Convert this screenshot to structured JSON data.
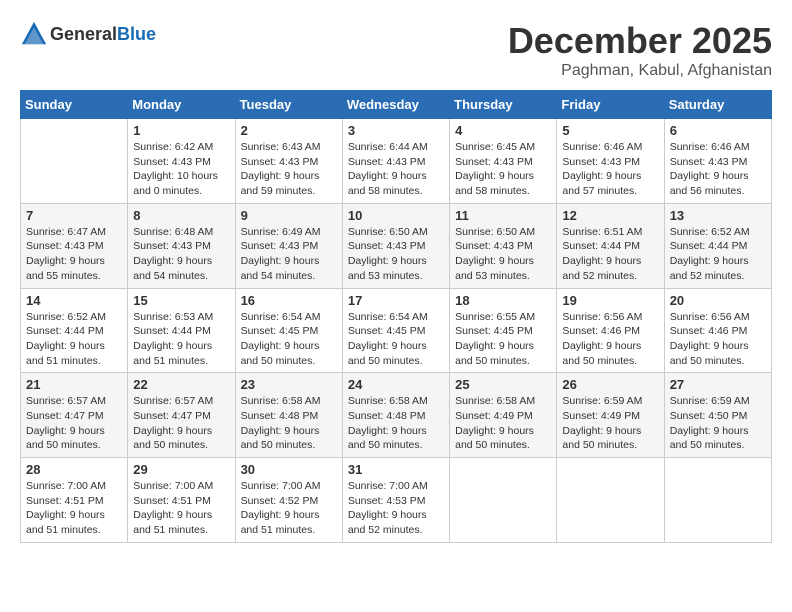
{
  "header": {
    "logo_general": "General",
    "logo_blue": "Blue",
    "month_title": "December 2025",
    "location": "Paghman, Kabul, Afghanistan"
  },
  "weekdays": [
    "Sunday",
    "Monday",
    "Tuesday",
    "Wednesday",
    "Thursday",
    "Friday",
    "Saturday"
  ],
  "weeks": [
    [
      {
        "day": "",
        "sunrise": "",
        "sunset": "",
        "daylight": ""
      },
      {
        "day": "1",
        "sunrise": "Sunrise: 6:42 AM",
        "sunset": "Sunset: 4:43 PM",
        "daylight": "Daylight: 10 hours and 0 minutes."
      },
      {
        "day": "2",
        "sunrise": "Sunrise: 6:43 AM",
        "sunset": "Sunset: 4:43 PM",
        "daylight": "Daylight: 9 hours and 59 minutes."
      },
      {
        "day": "3",
        "sunrise": "Sunrise: 6:44 AM",
        "sunset": "Sunset: 4:43 PM",
        "daylight": "Daylight: 9 hours and 58 minutes."
      },
      {
        "day": "4",
        "sunrise": "Sunrise: 6:45 AM",
        "sunset": "Sunset: 4:43 PM",
        "daylight": "Daylight: 9 hours and 58 minutes."
      },
      {
        "day": "5",
        "sunrise": "Sunrise: 6:46 AM",
        "sunset": "Sunset: 4:43 PM",
        "daylight": "Daylight: 9 hours and 57 minutes."
      },
      {
        "day": "6",
        "sunrise": "Sunrise: 6:46 AM",
        "sunset": "Sunset: 4:43 PM",
        "daylight": "Daylight: 9 hours and 56 minutes."
      }
    ],
    [
      {
        "day": "7",
        "sunrise": "Sunrise: 6:47 AM",
        "sunset": "Sunset: 4:43 PM",
        "daylight": "Daylight: 9 hours and 55 minutes."
      },
      {
        "day": "8",
        "sunrise": "Sunrise: 6:48 AM",
        "sunset": "Sunset: 4:43 PM",
        "daylight": "Daylight: 9 hours and 54 minutes."
      },
      {
        "day": "9",
        "sunrise": "Sunrise: 6:49 AM",
        "sunset": "Sunset: 4:43 PM",
        "daylight": "Daylight: 9 hours and 54 minutes."
      },
      {
        "day": "10",
        "sunrise": "Sunrise: 6:50 AM",
        "sunset": "Sunset: 4:43 PM",
        "daylight": "Daylight: 9 hours and 53 minutes."
      },
      {
        "day": "11",
        "sunrise": "Sunrise: 6:50 AM",
        "sunset": "Sunset: 4:43 PM",
        "daylight": "Daylight: 9 hours and 53 minutes."
      },
      {
        "day": "12",
        "sunrise": "Sunrise: 6:51 AM",
        "sunset": "Sunset: 4:44 PM",
        "daylight": "Daylight: 9 hours and 52 minutes."
      },
      {
        "day": "13",
        "sunrise": "Sunrise: 6:52 AM",
        "sunset": "Sunset: 4:44 PM",
        "daylight": "Daylight: 9 hours and 52 minutes."
      }
    ],
    [
      {
        "day": "14",
        "sunrise": "Sunrise: 6:52 AM",
        "sunset": "Sunset: 4:44 PM",
        "daylight": "Daylight: 9 hours and 51 minutes."
      },
      {
        "day": "15",
        "sunrise": "Sunrise: 6:53 AM",
        "sunset": "Sunset: 4:44 PM",
        "daylight": "Daylight: 9 hours and 51 minutes."
      },
      {
        "day": "16",
        "sunrise": "Sunrise: 6:54 AM",
        "sunset": "Sunset: 4:45 PM",
        "daylight": "Daylight: 9 hours and 50 minutes."
      },
      {
        "day": "17",
        "sunrise": "Sunrise: 6:54 AM",
        "sunset": "Sunset: 4:45 PM",
        "daylight": "Daylight: 9 hours and 50 minutes."
      },
      {
        "day": "18",
        "sunrise": "Sunrise: 6:55 AM",
        "sunset": "Sunset: 4:45 PM",
        "daylight": "Daylight: 9 hours and 50 minutes."
      },
      {
        "day": "19",
        "sunrise": "Sunrise: 6:56 AM",
        "sunset": "Sunset: 4:46 PM",
        "daylight": "Daylight: 9 hours and 50 minutes."
      },
      {
        "day": "20",
        "sunrise": "Sunrise: 6:56 AM",
        "sunset": "Sunset: 4:46 PM",
        "daylight": "Daylight: 9 hours and 50 minutes."
      }
    ],
    [
      {
        "day": "21",
        "sunrise": "Sunrise: 6:57 AM",
        "sunset": "Sunset: 4:47 PM",
        "daylight": "Daylight: 9 hours and 50 minutes."
      },
      {
        "day": "22",
        "sunrise": "Sunrise: 6:57 AM",
        "sunset": "Sunset: 4:47 PM",
        "daylight": "Daylight: 9 hours and 50 minutes."
      },
      {
        "day": "23",
        "sunrise": "Sunrise: 6:58 AM",
        "sunset": "Sunset: 4:48 PM",
        "daylight": "Daylight: 9 hours and 50 minutes."
      },
      {
        "day": "24",
        "sunrise": "Sunrise: 6:58 AM",
        "sunset": "Sunset: 4:48 PM",
        "daylight": "Daylight: 9 hours and 50 minutes."
      },
      {
        "day": "25",
        "sunrise": "Sunrise: 6:58 AM",
        "sunset": "Sunset: 4:49 PM",
        "daylight": "Daylight: 9 hours and 50 minutes."
      },
      {
        "day": "26",
        "sunrise": "Sunrise: 6:59 AM",
        "sunset": "Sunset: 4:49 PM",
        "daylight": "Daylight: 9 hours and 50 minutes."
      },
      {
        "day": "27",
        "sunrise": "Sunrise: 6:59 AM",
        "sunset": "Sunset: 4:50 PM",
        "daylight": "Daylight: 9 hours and 50 minutes."
      }
    ],
    [
      {
        "day": "28",
        "sunrise": "Sunrise: 7:00 AM",
        "sunset": "Sunset: 4:51 PM",
        "daylight": "Daylight: 9 hours and 51 minutes."
      },
      {
        "day": "29",
        "sunrise": "Sunrise: 7:00 AM",
        "sunset": "Sunset: 4:51 PM",
        "daylight": "Daylight: 9 hours and 51 minutes."
      },
      {
        "day": "30",
        "sunrise": "Sunrise: 7:00 AM",
        "sunset": "Sunset: 4:52 PM",
        "daylight": "Daylight: 9 hours and 51 minutes."
      },
      {
        "day": "31",
        "sunrise": "Sunrise: 7:00 AM",
        "sunset": "Sunset: 4:53 PM",
        "daylight": "Daylight: 9 hours and 52 minutes."
      },
      {
        "day": "",
        "sunrise": "",
        "sunset": "",
        "daylight": ""
      },
      {
        "day": "",
        "sunrise": "",
        "sunset": "",
        "daylight": ""
      },
      {
        "day": "",
        "sunrise": "",
        "sunset": "",
        "daylight": ""
      }
    ]
  ]
}
